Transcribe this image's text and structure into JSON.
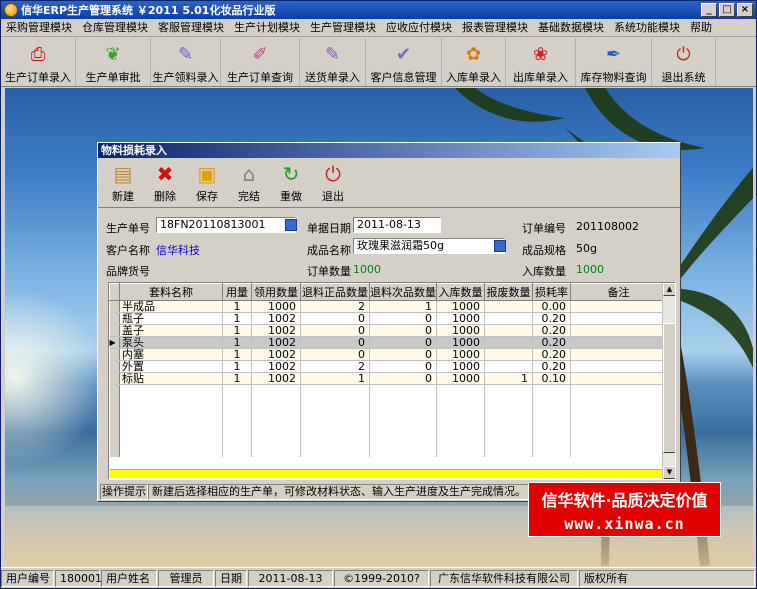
{
  "window": {
    "title": "信华ERP生产管理系统  ￥2011 5.01化妆品行业版"
  },
  "menu": [
    "采购管理模块",
    "仓库管理模块",
    "客服管理模块",
    "生产计划模块",
    "生产管理模块",
    "应收应付模块",
    "报表管理模块",
    "基础数据模块",
    "系统功能模块",
    "帮助"
  ],
  "toolbar": [
    {
      "label": "生产订单录入",
      "icon": "pdf-document-icon",
      "color": "#d01010"
    },
    {
      "label": "生产单审批",
      "icon": "plant-leaf-icon",
      "color": "#3aa030"
    },
    {
      "label": "生产领料录入",
      "icon": "document-pen-icon",
      "color": "#7a5ab8"
    },
    {
      "label": "生产订单查询",
      "icon": "document-search-icon",
      "color": "#c04080"
    },
    {
      "label": "送货单录入",
      "icon": "document-pen-icon",
      "color": "#8060c0"
    },
    {
      "label": "客户信息管理",
      "icon": "document-check-icon",
      "color": "#7070c0"
    },
    {
      "label": "入库单录入",
      "icon": "flower-icon",
      "color": "#e07810"
    },
    {
      "label": "出库单录入",
      "icon": "flower-red-icon",
      "color": "#d02020"
    },
    {
      "label": "库存物料查询",
      "icon": "quill-icon",
      "color": "#2060c0"
    },
    {
      "label": "退出系统",
      "icon": "exit-icon",
      "color": "#d02020"
    }
  ],
  "dialog": {
    "title": "物料损耗录入",
    "toolbar": [
      {
        "label": "新建",
        "icon": "new-document-icon"
      },
      {
        "label": "删除",
        "icon": "delete-x-icon"
      },
      {
        "label": "保存",
        "icon": "save-floppy-icon"
      },
      {
        "label": "完结",
        "icon": "home-finish-icon"
      },
      {
        "label": "重做",
        "icon": "redo-icon"
      },
      {
        "label": "退出",
        "icon": "exit-icon"
      }
    ],
    "form": {
      "order_no_label": "生产单号",
      "order_no": "18FN20110813001",
      "doc_date_label": "单据日期",
      "doc_date": "2011-08-13",
      "sales_no_label": "订单编号",
      "sales_no": "201108002",
      "customer_label": "客户名称",
      "customer": "信华科技",
      "product_label": "成品名称",
      "product": "玫瑰果滋润霜50g",
      "spec_label": "成品规格",
      "spec": "50g",
      "brand_label": "品牌货号",
      "brand": "",
      "order_qty_label": "订单数量",
      "order_qty": "1000",
      "in_qty_label": "入库数量",
      "in_qty": "1000"
    },
    "grid": {
      "columns": [
        "套料名称",
        "用量",
        "领用数量",
        "退料正品数量",
        "退料次品数量",
        "入库数量",
        "报废数量",
        "损耗率",
        "备注"
      ],
      "selected_row": 3,
      "rows": [
        [
          "半成品",
          "1",
          "1000",
          "2",
          "1",
          "1000",
          "",
          "0.00",
          ""
        ],
        [
          "瓶子",
          "1",
          "1002",
          "0",
          "0",
          "1000",
          "",
          "0.20",
          ""
        ],
        [
          "盖子",
          "1",
          "1002",
          "0",
          "0",
          "1000",
          "",
          "0.20",
          ""
        ],
        [
          "泵头",
          "1",
          "1002",
          "0",
          "0",
          "1000",
          "",
          "0.20",
          ""
        ],
        [
          "内塞",
          "1",
          "1002",
          "0",
          "0",
          "1000",
          "",
          "0.20",
          ""
        ],
        [
          "外置",
          "1",
          "1002",
          "2",
          "0",
          "1000",
          "",
          "0.20",
          ""
        ],
        [
          "标贴",
          "1",
          "1002",
          "1",
          "0",
          "1000",
          "1",
          "0.10",
          ""
        ]
      ]
    },
    "hint_label": "操作提示",
    "hint_text": "新建后选择相应的生产单，可修改材料状态、输入生产进度及生产完成情况。"
  },
  "watermark": {
    "line1": "信华软件·品质决定价值",
    "line2": "www.xinwa.cn"
  },
  "status": {
    "user_no_label": "用户编号",
    "user_no": "180001",
    "user_name_label": "用户姓名",
    "user_name": "管理员",
    "date_label": "日期",
    "date": "2011-08-13",
    "copyright": "©1999-2010?",
    "company": "广东信华软件科技有限公司",
    "rights": "版权所有"
  }
}
